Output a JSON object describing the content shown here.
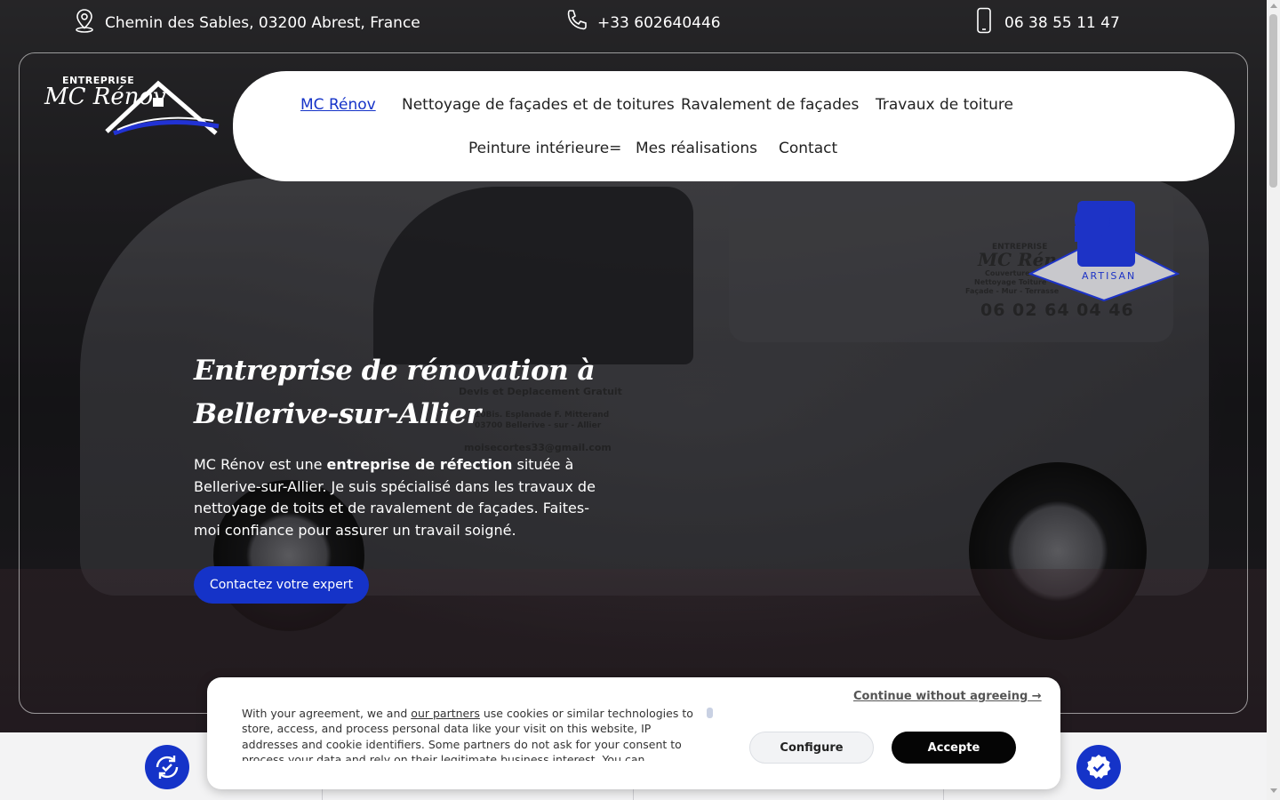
{
  "topbar": {
    "address": "Chemin des Sables, 03200 Abrest, France",
    "phone_main": "+33 602640446",
    "phone_mobile": "06 38 55 11 47"
  },
  "logo": {
    "small_text": "ENTREPRISE",
    "brand": "MC Rénov"
  },
  "nav": {
    "items": [
      {
        "label": "MC Rénov",
        "active": true
      },
      {
        "label": "Nettoyage de façades et de toitures"
      },
      {
        "label": "Ravalement de façades"
      },
      {
        "label": "Travaux de toiture"
      },
      {
        "label": "Peinture intérieure="
      },
      {
        "label": "Mes réalisations"
      },
      {
        "label": "Contact"
      }
    ]
  },
  "badge": {
    "label": "ARTISAN"
  },
  "van": {
    "logo_small": "ENTREPRISE",
    "logo": "MC Rénov",
    "services1": "Couverture",
    "services2": "Nettoyage Toiture",
    "services3": "Façade - Mur - Terrasse",
    "phone": "06 02 64 04 46",
    "devis": "Devis et Deplacement Gratuit",
    "address1": "10Bis. Esplanade F. Mitterand",
    "address2": "03700 Bellerive - sur - Allier",
    "email": "moisecortes33@gmail.com"
  },
  "hero": {
    "title": "Entreprise de rénovation à Bellerive-sur-Allier",
    "text_before": "MC Rénov est une ",
    "text_bold": "entreprise de réfection",
    "text_after": " située à Bellerive-sur-Allier. Je suis spécialisé dans les travaux de nettoyage de toits et de ravalement de façades. Faites-moi confiance pour assurer un travail soigné.",
    "cta": "Contactez votre expert"
  },
  "cookie": {
    "text_before": "With your agreement, we and ",
    "partners_link": "our partners",
    "text_after": " use cookies or similar technologies to store, access, and process personal data like your visit on this website, IP addresses and cookie identifiers. Some partners do not ask for your consent to process your data and rely on their legitimate business interest. You can",
    "continue": "Continue without agreeing →",
    "configure": "Configure",
    "accept": "Accepte"
  },
  "colors": {
    "accent": "#1533c8",
    "accept_button": "#050505"
  },
  "icons": [
    "location-pin-icon",
    "phone-icon",
    "mobile-phone-icon",
    "refresh-check-icon",
    "verified-badge-icon"
  ]
}
